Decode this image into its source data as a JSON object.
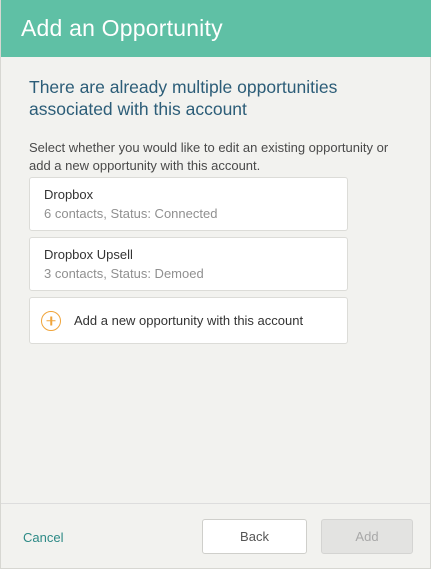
{
  "header": {
    "title": "Add an Opportunity"
  },
  "main": {
    "heading": "There are already multiple opportunities associated with this account",
    "instructions": "Select whether you would like to edit an existing opportunity or add a new opportunity with this account.",
    "opportunities": [
      {
        "name": "Dropbox",
        "meta": "6 contacts, Status: Connected"
      },
      {
        "name": "Dropbox Upsell",
        "meta": "3 contacts, Status: Demoed"
      }
    ],
    "add_new_label": "Add a new opportunity with this account"
  },
  "footer": {
    "cancel_label": "Cancel",
    "back_label": "Back",
    "add_label": "Add",
    "add_disabled": true
  },
  "colors": {
    "header_bg": "#5fc0a5",
    "heading_text": "#2c5d78",
    "link": "#2d8a86",
    "plus_accent": "#f0a43a"
  },
  "icons": {
    "add_opportunity": "plus-circle-icon"
  }
}
